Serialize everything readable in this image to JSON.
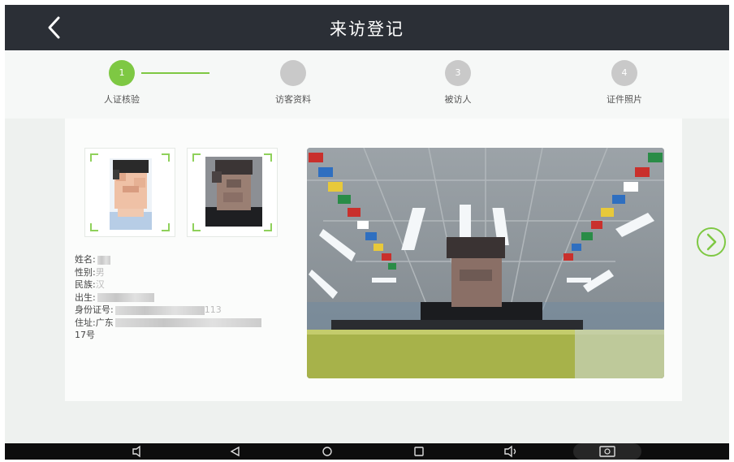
{
  "header": {
    "title": "来访登记",
    "back_icon": "chevron-left-icon"
  },
  "stepper": {
    "steps": [
      {
        "number": "1",
        "label": "人证核验",
        "active": true
      },
      {
        "number": "",
        "label": "访客资料",
        "active": false
      },
      {
        "number": "3",
        "label": "被访人",
        "active": false
      },
      {
        "number": "4",
        "label": "证件照片",
        "active": false
      }
    ],
    "accent": "#7ec843"
  },
  "info": {
    "name_label": "姓名:",
    "gender_label": "性别:",
    "gender_partial": "男",
    "ethnicity_label": "民族:",
    "ethnicity_partial": "汉",
    "birth_label": "出生:",
    "id_label": "身份证号:",
    "id_partial": "113",
    "address_label": "住址:",
    "address_partial": "广东",
    "address_line2": "17号"
  },
  "icons": {
    "next": "chevron-right-circle-icon",
    "nav": [
      "volume-down-icon",
      "back-icon",
      "home-icon",
      "recents-icon",
      "volume-up-icon",
      "screenshot-icon"
    ]
  }
}
